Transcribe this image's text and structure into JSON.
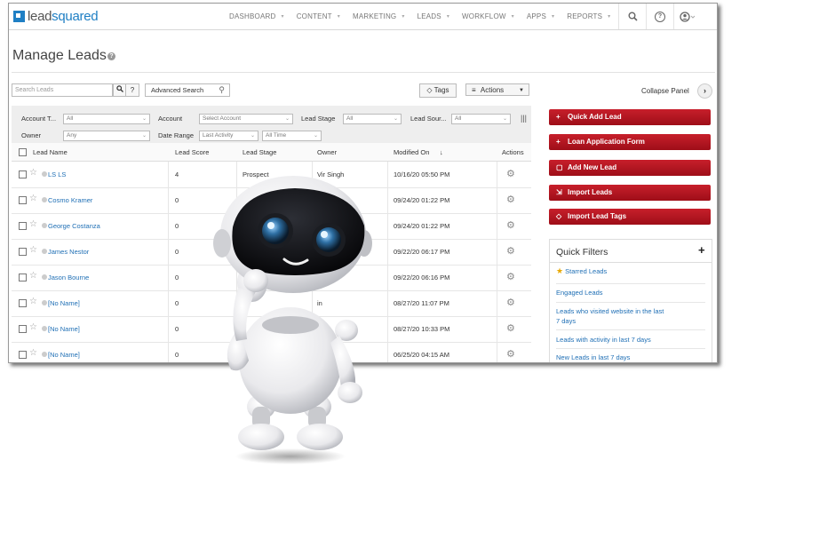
{
  "app": {
    "logo_text_part1": "lead",
    "logo_text_part2": "squared"
  },
  "nav": {
    "items": [
      {
        "label": "DASHBOARD"
      },
      {
        "label": "CONTENT"
      },
      {
        "label": "MARKETING"
      },
      {
        "label": "LEADS"
      },
      {
        "label": "WORKFLOW"
      },
      {
        "label": "APPS"
      },
      {
        "label": "REPORTS"
      }
    ],
    "help_icon_label": "?"
  },
  "page": {
    "title": "Manage Leads",
    "help_mark": "?"
  },
  "toolbar": {
    "search_placeholder": "Search Leads",
    "search_icon_glyph": "🔍",
    "help_label": "?",
    "advanced_search_label": "Advanced Search",
    "tags_label": "Tags",
    "actions_label": "Actions",
    "collapse_label": "Collapse Panel"
  },
  "filters": {
    "account_type_label": "Account T...",
    "account_type_value": "All",
    "account_label": "Account",
    "account_value": "Select Account",
    "lead_stage_label": "Lead Stage",
    "lead_stage_value": "All",
    "lead_source_label": "Lead Sour...",
    "lead_source_value": "All",
    "owner_label": "Owner",
    "owner_value": "Any",
    "date_range_label": "Date Range",
    "date_range_value": "Last Activity",
    "date_range_period": "All Time"
  },
  "table": {
    "headers": {
      "lead_name": "Lead Name",
      "lead_score": "Lead Score",
      "lead_stage": "Lead Stage",
      "owner": "Owner",
      "modified_on": "Modified On",
      "sort_arrow": "↓",
      "actions": "Actions"
    },
    "rows": [
      {
        "name": "LS LS",
        "score": "4",
        "stage": "Prospect",
        "owner": "Vir Singh",
        "modified": "10/16/20 05:50 PM"
      },
      {
        "name": "Cosmo Kramer",
        "score": "0",
        "stage": "",
        "owner": "",
        "modified": "09/24/20 01:22 PM"
      },
      {
        "name": "George Costanza",
        "score": "0",
        "stage": "",
        "owner": "",
        "modified": "09/24/20 01:22 PM"
      },
      {
        "name": "James Nestor",
        "score": "0",
        "stage": "",
        "owner": "",
        "modified": "09/22/20 06:17 PM"
      },
      {
        "name": "Jason Bourne",
        "score": "0",
        "stage": "",
        "owner": "",
        "modified": "09/22/20 06:16 PM"
      },
      {
        "name": "[No Name]",
        "score": "0",
        "stage": "",
        "owner": "in",
        "modified": "08/27/20 11:07 PM"
      },
      {
        "name": "[No Name]",
        "score": "0",
        "stage": "",
        "owner": "",
        "modified": "08/27/20 10:33 PM"
      },
      {
        "name": "[No Name]",
        "score": "0",
        "stage": "",
        "owner": "",
        "modified": "06/25/20 04:15 AM"
      }
    ]
  },
  "panel": {
    "buttons": [
      {
        "icon": "+",
        "label": "Quick Add Lead"
      },
      {
        "icon": "+",
        "label": "Loan Application Form"
      },
      {
        "icon": "▢",
        "label": "Add New Lead"
      },
      {
        "icon": "⇲",
        "label": "Import Leads"
      },
      {
        "icon": "◇",
        "label": "Import Lead Tags"
      }
    ],
    "quick_filters": {
      "title": "Quick Filters",
      "add_label": "+",
      "items": [
        "Starred Leads",
        "Engaged Leads",
        "Leads who visited website in the last 7 days",
        "Leads with activity in last 7 days",
        "New Leads in last 7 days"
      ]
    }
  },
  "colors": {
    "brand_blue": "#1f7fc4",
    "button_red": "#b5151f",
    "link_blue": "#1f6fb5"
  }
}
